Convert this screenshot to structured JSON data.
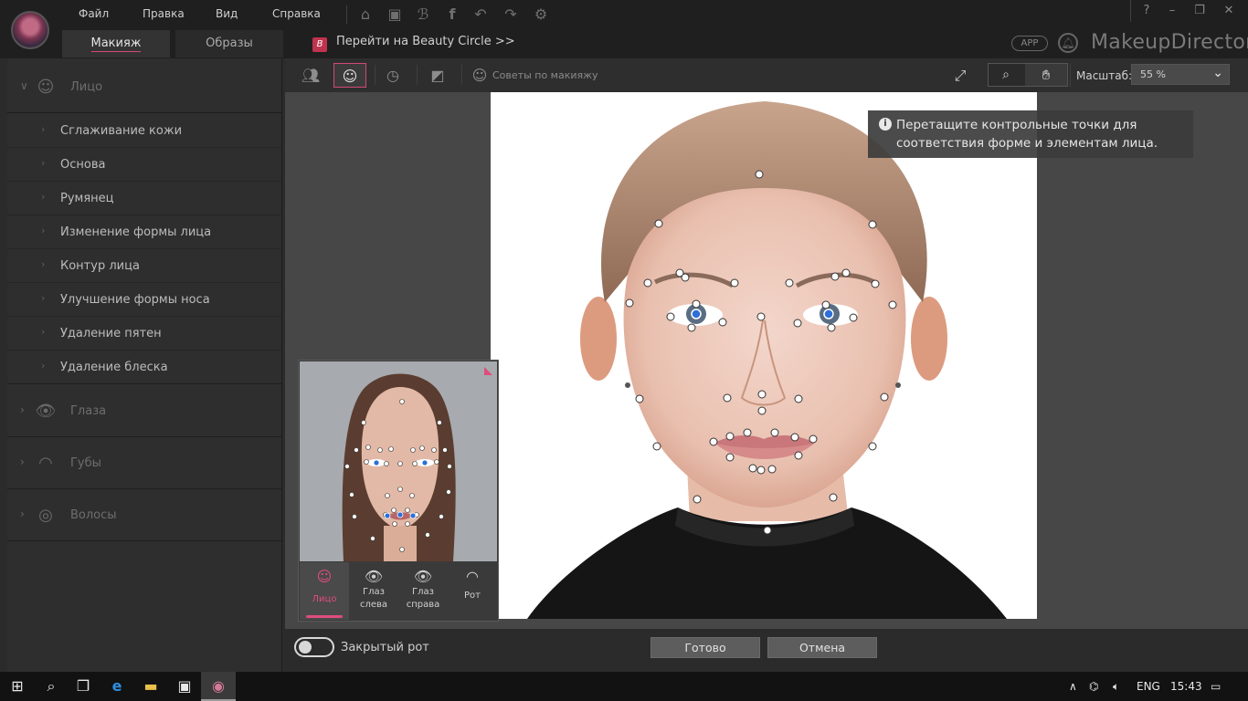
{
  "menu": {
    "file": "Файл",
    "edit": "Правка",
    "view": "Вид",
    "help": "Справка"
  },
  "tabs": {
    "makeup": "Макияж",
    "looks": "Образы"
  },
  "beauty_circle": {
    "icon_letter": "B",
    "label": "Перейти на Beauty Circle >>"
  },
  "app_badge": "APP",
  "brand": "MakeupDirector",
  "window_controls": {
    "help": "?",
    "minimize": "–",
    "restore": "❐",
    "close": "✕"
  },
  "left_panel": {
    "face": {
      "label": "Лицо",
      "icon": "face-icon",
      "items": [
        "Сглаживание кожи",
        "Основа",
        "Румянец",
        "Изменение формы лица",
        "Контур лица",
        "Улучшение формы носа",
        "Удаление пятен",
        "Удаление блеска"
      ]
    },
    "eyes": {
      "label": "Глаза",
      "icon": "eye-icon"
    },
    "lips": {
      "label": "Губы",
      "icon": "lips-icon"
    },
    "hair": {
      "label": "Волосы",
      "icon": "hair-icon"
    }
  },
  "toolbar": {
    "tips": "Советы по макияжу",
    "scale_label": "Масштаб:",
    "scale_value": "55 %"
  },
  "hint": {
    "text": "Перетащите контрольные точки для соответствия форме и элементам лица."
  },
  "preview": {
    "tabs": [
      {
        "label": "Лицо",
        "icon": "face-outline-icon"
      },
      {
        "label": "Глаз слева",
        "icon": "left-eye-icon"
      },
      {
        "label": "Глаз справа",
        "icon": "right-eye-icon"
      },
      {
        "label": "Рот",
        "icon": "mouth-icon"
      }
    ]
  },
  "bottom": {
    "closed_mouth": "Закрытый рот",
    "done": "Готово",
    "cancel": "Отмена"
  },
  "taskbar": {
    "lang": "ENG",
    "time": "15:43"
  },
  "colors": {
    "accent": "#d24a73",
    "panel": "#2e2e2e",
    "canvas": "#474747",
    "control_point": "#ffffff",
    "pupil_point": "#2e6fd8"
  }
}
